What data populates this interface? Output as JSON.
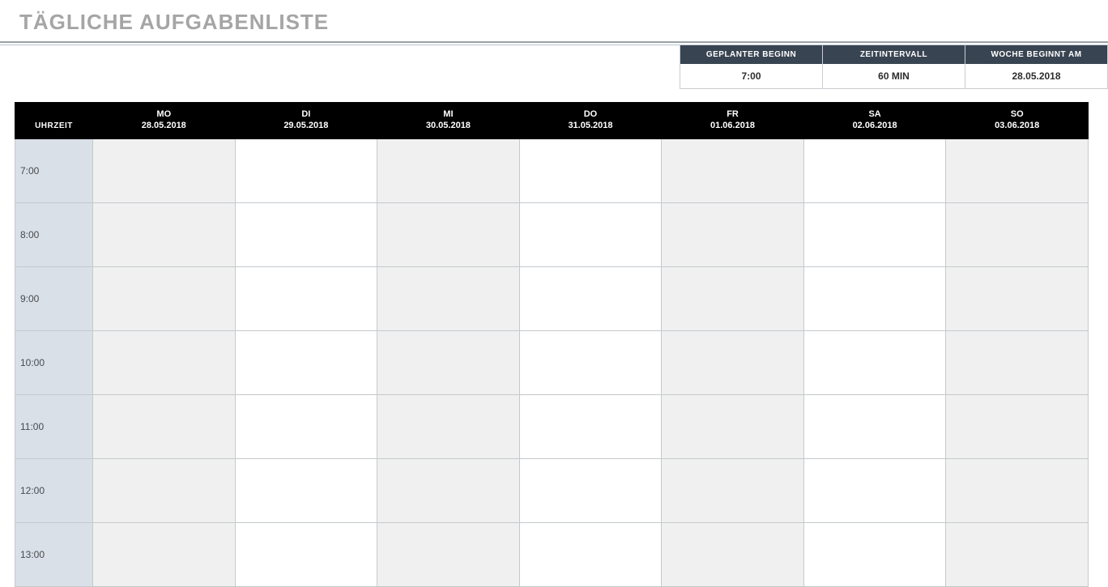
{
  "title": "TÄGLICHE AUFGABENLISTE",
  "meta": {
    "cols": [
      {
        "label": "GEPLANTER BEGINN",
        "value": "7:00"
      },
      {
        "label": "ZEITINTERVALL",
        "value": "60 MIN"
      },
      {
        "label": "WOCHE BEGINNT AM",
        "value": "28.05.2018"
      }
    ]
  },
  "schedule": {
    "time_header": "UHRZEIT",
    "days": [
      {
        "dow": "MO",
        "date": "28.05.2018"
      },
      {
        "dow": "DI",
        "date": "29.05.2018"
      },
      {
        "dow": "MI",
        "date": "30.05.2018"
      },
      {
        "dow": "DO",
        "date": "31.05.2018"
      },
      {
        "dow": "FR",
        "date": "01.06.2018"
      },
      {
        "dow": "SA",
        "date": "02.06.2018"
      },
      {
        "dow": "SO",
        "date": "03.06.2018"
      }
    ],
    "times": [
      "7:00",
      "8:00",
      "9:00",
      "10:00",
      "11:00",
      "12:00",
      "13:00"
    ]
  }
}
